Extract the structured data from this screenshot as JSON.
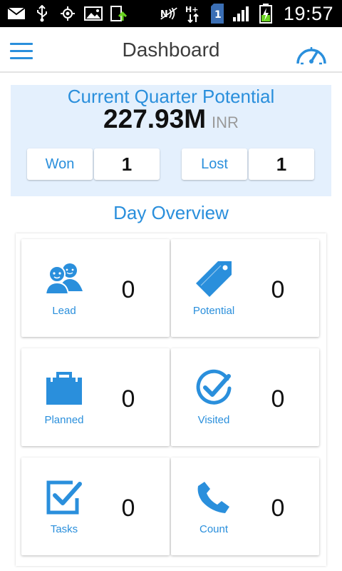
{
  "statusbar": {
    "time": "19:57",
    "network_type": "H+",
    "sim_slot": "1"
  },
  "appbar": {
    "title": "Dashboard",
    "menu_icon": "hamburger-menu-icon",
    "right_icon": "speedometer-icon"
  },
  "quarter": {
    "title": "Current Quarter Potential",
    "amount": "227.93M",
    "unit": "INR",
    "won_label": "Won",
    "won_value": "1",
    "lost_label": "Lost",
    "lost_value": "1"
  },
  "day_overview": {
    "title": "Day Overview",
    "cards": [
      {
        "label": "Lead",
        "value": "0",
        "icon": "users-icon"
      },
      {
        "label": "Potential",
        "value": "0",
        "icon": "price-tag-icon"
      },
      {
        "label": "Planned",
        "value": "0",
        "icon": "briefcase-icon"
      },
      {
        "label": "Visited",
        "value": "0",
        "icon": "check-circle-icon"
      },
      {
        "label": "Tasks",
        "value": "0",
        "icon": "checkbox-icon"
      },
      {
        "label": "Count",
        "value": "0",
        "icon": "phone-icon"
      }
    ]
  },
  "colors": {
    "accent": "#2a8fdc",
    "panel_bg": "#e4f0fd",
    "text_dark": "#111111"
  }
}
